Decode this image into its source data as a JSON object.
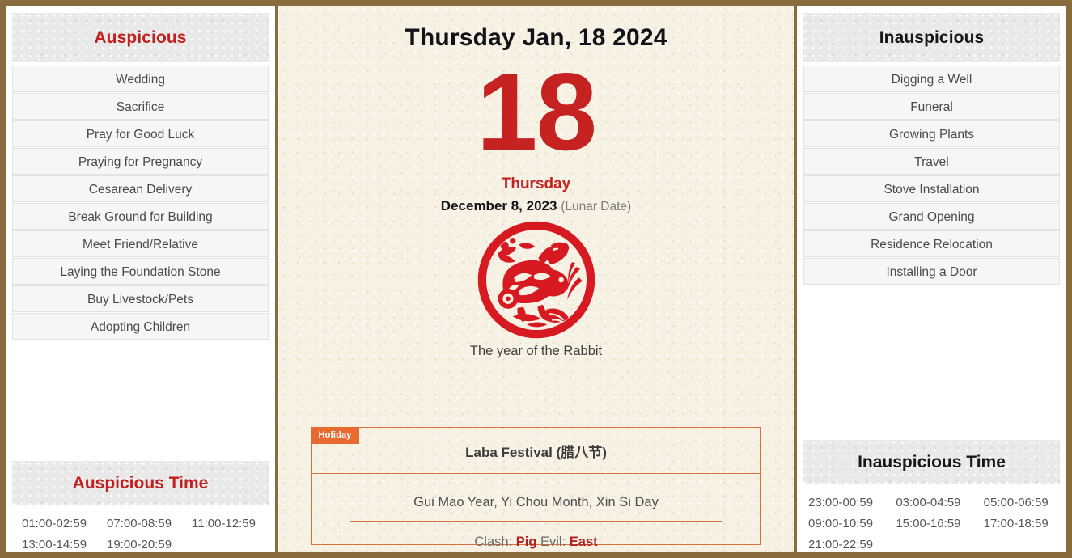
{
  "theme": {
    "border_brown": "#8a6b3d",
    "accent_red": "#c21f1f",
    "day_red": "#c62222",
    "holiday_orange": "#e86a30",
    "festival_border": "#d9713e",
    "paper_cream": "#f7f1e3",
    "header_gray": "#e9e9e9"
  },
  "left_panel": {
    "title": "Auspicious",
    "items": [
      "Wedding",
      "Sacrifice",
      "Pray for Good Luck",
      "Praying for Pregnancy",
      "Cesarean Delivery",
      "Break Ground for Building",
      "Meet Friend/Relative",
      "Laying the Foundation Stone",
      "Buy Livestock/Pets",
      "Adopting Children"
    ],
    "time_title": "Auspicious Time",
    "time_slots": [
      "01:00-02:59",
      "07:00-08:59",
      "11:00-12:59",
      "13:00-14:59",
      "19:00-20:59"
    ]
  },
  "center": {
    "headline": "Thursday Jan, 18 2024",
    "day_number": "18",
    "weekday": "Thursday",
    "lunar_date": "December 8, 2023",
    "lunar_tag": "(Lunar Date)",
    "zodiac_icon": "rabbit-papercut-icon",
    "zodiac_caption": "The year of the Rabbit",
    "festival": {
      "badge": "Holiday",
      "name": "Laba Festival (腊八节)",
      "ganzhi": "Gui Mao Year, Yi Chou Month, Xin Si Day",
      "clash_label": "Clash:",
      "clash_value": "Pig",
      "evil_label": "Evil:",
      "evil_value": "East"
    }
  },
  "right_panel": {
    "title": "Inauspicious",
    "items": [
      "Digging a Well",
      "Funeral",
      "Growing Plants",
      "Travel",
      "Stove Installation",
      "Grand Opening",
      "Residence Relocation",
      "Installing a Door"
    ],
    "time_title": "Inauspicious Time",
    "time_slots": [
      "23:00-00:59",
      "03:00-04:59",
      "05:00-06:59",
      "09:00-10:59",
      "15:00-16:59",
      "17:00-18:59",
      "21:00-22:59"
    ]
  }
}
